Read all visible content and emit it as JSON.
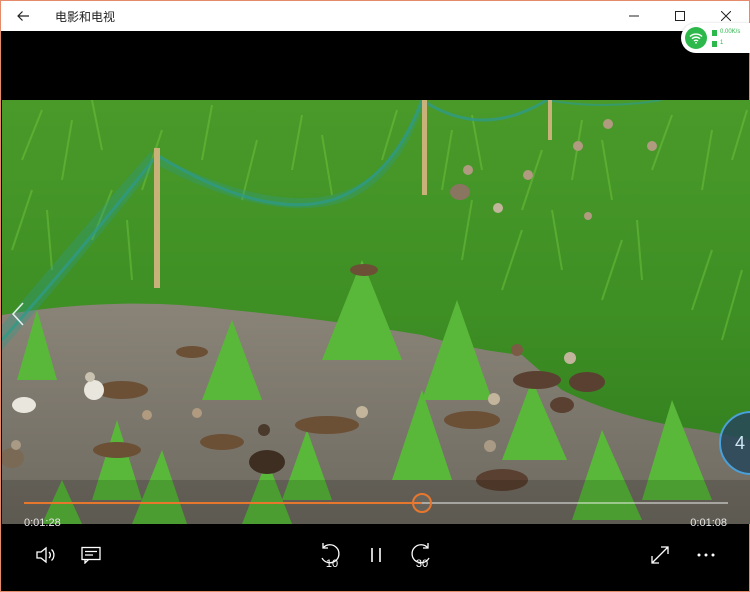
{
  "app": {
    "title": "电影和电视"
  },
  "network": {
    "speed": "0.00K/s",
    "connections": "1"
  },
  "playback": {
    "elapsed": "0:01:28",
    "remaining": "0:01:08",
    "progress": 0.565,
    "skip_back_seconds": "10",
    "skip_forward_seconds": "30"
  },
  "side_widget": {
    "value": "4"
  },
  "colors": {
    "accent": "#e8772e",
    "network_green": "#2db84c",
    "window_border": "#e58b6b"
  }
}
